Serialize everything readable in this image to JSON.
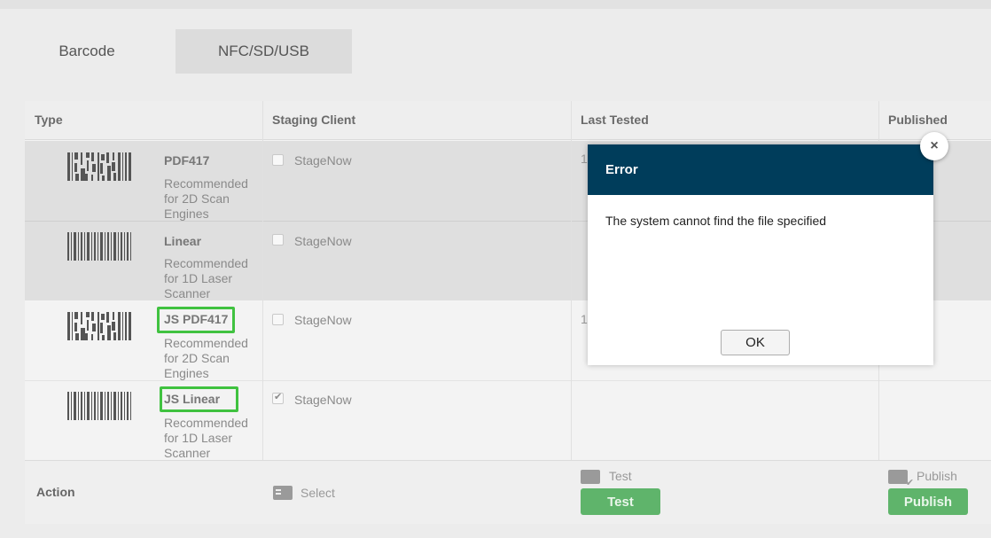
{
  "tabs": [
    {
      "label": "Barcode"
    },
    {
      "label": "NFC/SD/USB"
    }
  ],
  "table": {
    "headers": {
      "type": "Type",
      "staging_client": "Staging Client",
      "last_tested": "Last Tested",
      "published": "Published"
    },
    "rows": [
      {
        "name": "PDF417",
        "desc": "Recommended for 2D Scan Engines",
        "client": "StageNow",
        "checked": false,
        "last_tested_partial": "1",
        "barcode_icon": "pdf417-barcode-icon"
      },
      {
        "name": "Linear",
        "desc": "Recommended for 1D Laser Scanner",
        "client": "StageNow",
        "checked": false,
        "last_tested_partial": "",
        "barcode_icon": "linear-barcode-icon"
      },
      {
        "name": "JS PDF417",
        "desc": "Recommended for 2D Scan Engines",
        "client": "StageNow",
        "checked": false,
        "last_tested_partial": "1",
        "barcode_icon": "pdf417-barcode-icon"
      },
      {
        "name": "JS Linear",
        "desc": "Recommended for 1D Laser Scanner",
        "client": "StageNow",
        "checked": true,
        "last_tested_partial": "",
        "barcode_icon": "linear-barcode-icon"
      }
    ],
    "action": {
      "label": "Action",
      "select_label": "Select",
      "test_label": "Test",
      "test_button": "Test",
      "publish_label": "Publish",
      "publish_button": "Publish"
    }
  },
  "modal": {
    "title": "Error",
    "message": "The system cannot find the file specified",
    "ok_label": "OK",
    "close_glyph": "×"
  },
  "colors": {
    "modal_header": "#003d5b",
    "highlight": "#40c240",
    "button_green": "#5fb46b"
  }
}
